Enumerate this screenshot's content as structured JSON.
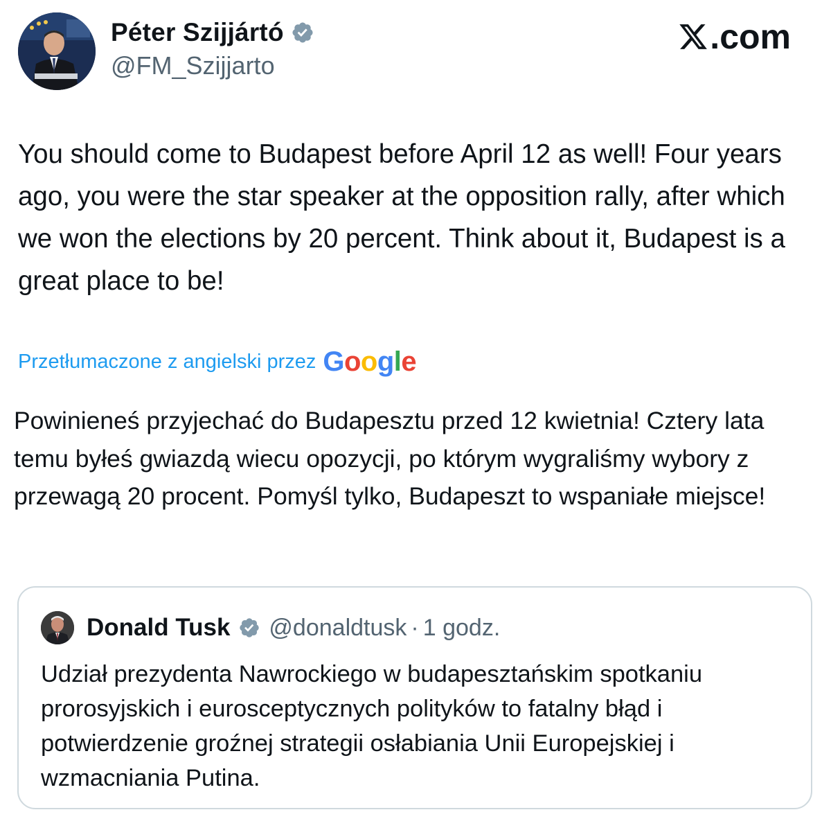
{
  "post": {
    "author": {
      "name": "Péter Szijjártó",
      "handle": "@FM_Szijjarto",
      "verified_icon": "verified-badge-icon"
    },
    "site_logo_text": ".com",
    "text": "You should come to Budapest before April 12 as well! Four years ago, you were the star speaker at the opposition rally, after which we won the elections by 20 percent. Think about it, Budapest is a great place to be!",
    "translation": {
      "label": "Przetłumaczone z angielski przez",
      "provider": [
        "G",
        "o",
        "o",
        "g",
        "l",
        "e"
      ],
      "text": "Powinieneś przyjechać do Budapesztu przed 12 kwietnia! Cztery lata temu byłeś gwiazdą wiecu opozycji, po którym wygraliśmy wybory z przewagą 20 procent. Pomyśl tylko, Budapeszt to wspaniałe miejsce!"
    },
    "quoted": {
      "name": "Donald Tusk",
      "handle": "@donaldtusk",
      "separator": "·",
      "time": "1 godz.",
      "text": "Udział prezydenta Nawrockiego w budapesztańskim spotkaniu prorosyjskich i eurosceptycznych polityków to fatalny błąd i potwierdzenie groźnej strategii osłabiania Unii Europejskiej i wzmacniania Putina."
    }
  },
  "colors": {
    "text": "#0f1419",
    "secondary": "#536471",
    "link": "#1d9bf0",
    "verified": "#829aab",
    "card_border": "#cfd9de",
    "google_blue": "#4285F4",
    "google_red": "#EA4335",
    "google_yellow": "#FBBC05",
    "google_green": "#34A853"
  }
}
